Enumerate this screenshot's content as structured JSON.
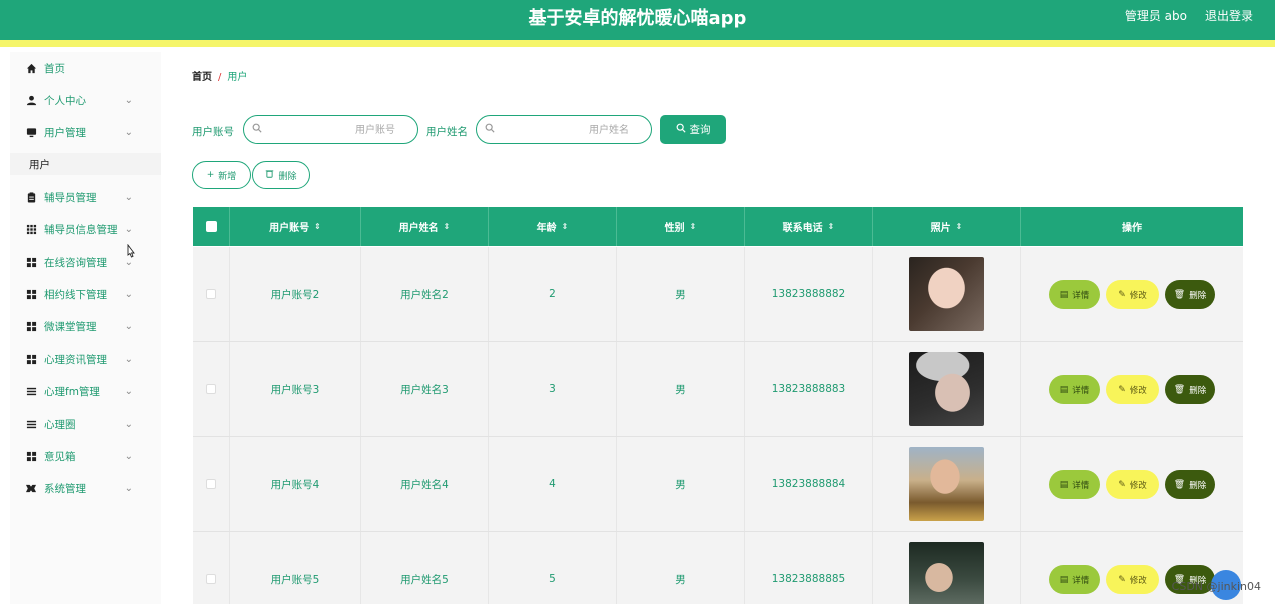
{
  "header": {
    "title": "基于安卓的解忧暖心喵app",
    "user_label": "管理员 abo",
    "logout_label": "退出登录"
  },
  "sidebar": {
    "items": [
      {
        "label": "首页",
        "icon": "home-icon",
        "expandable": false
      },
      {
        "label": "个人中心",
        "icon": "person-icon",
        "expandable": true
      },
      {
        "label": "用户管理",
        "icon": "monitor-icon",
        "expandable": true
      },
      {
        "label": "辅导员管理",
        "icon": "clipboard-icon",
        "expandable": true
      },
      {
        "label": "辅导员信息管理",
        "icon": "grid9-icon",
        "expandable": true
      },
      {
        "label": "在线咨询管理",
        "icon": "grid4-icon",
        "expandable": true
      },
      {
        "label": "相约线下管理",
        "icon": "grid4-icon",
        "expandable": true
      },
      {
        "label": "微课堂管理",
        "icon": "grid4-icon",
        "expandable": true
      },
      {
        "label": "心理资讯管理",
        "icon": "grid4-icon",
        "expandable": true
      },
      {
        "label": "心理fm管理",
        "icon": "list-icon",
        "expandable": true
      },
      {
        "label": "心理圈",
        "icon": "list-icon",
        "expandable": true
      },
      {
        "label": "意见箱",
        "icon": "grid4-icon",
        "expandable": true
      },
      {
        "label": "系统管理",
        "icon": "settings-icon",
        "expandable": true
      }
    ],
    "submenu_active": "用户"
  },
  "breadcrumb": {
    "home": "首页",
    "separator": "/",
    "current": "用户"
  },
  "search": {
    "account_label": "用户账号",
    "account_placeholder": "用户账号",
    "name_label": "用户姓名",
    "name_placeholder": "用户姓名",
    "query_label": "查询"
  },
  "toolbar": {
    "add_label": "新增",
    "delete_label": "删除"
  },
  "table": {
    "columns": [
      "用户账号",
      "用户姓名",
      "年龄",
      "性别",
      "联系电话",
      "照片",
      "操作"
    ],
    "rows": [
      {
        "account": "用户账号2",
        "name": "用户姓名2",
        "age": "2",
        "gender": "男",
        "phone": "13823888882"
      },
      {
        "account": "用户账号3",
        "name": "用户姓名3",
        "age": "3",
        "gender": "男",
        "phone": "13823888883"
      },
      {
        "account": "用户账号4",
        "name": "用户姓名4",
        "age": "4",
        "gender": "男",
        "phone": "13823888884"
      },
      {
        "account": "用户账号5",
        "name": "用户姓名5",
        "age": "5",
        "gender": "男",
        "phone": "13823888885"
      }
    ],
    "actions": {
      "detail": "详情",
      "edit": "修改",
      "delete": "删除"
    }
  },
  "overlay": {
    "watermark": "CSDN @jinkin04"
  },
  "colors": {
    "primary": "#1fa67a",
    "accent_strip": "#f5f56a",
    "detail_btn": "#9bc93c",
    "edit_btn": "#f8f45a",
    "delete_btn": "#3c5a0e"
  }
}
